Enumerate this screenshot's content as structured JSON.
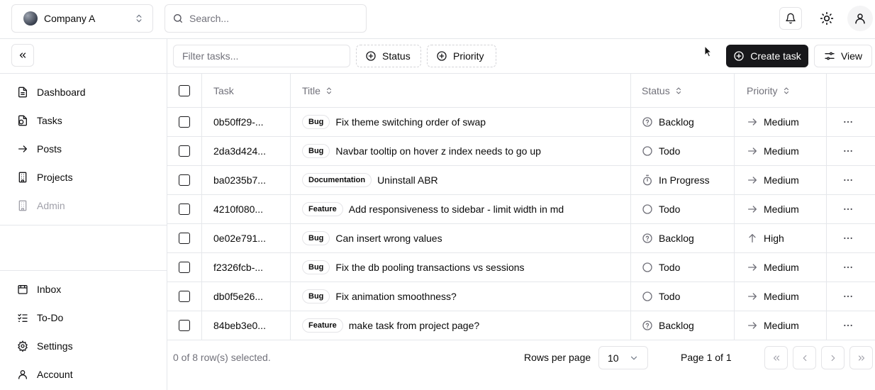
{
  "header": {
    "company": "Company A",
    "search_placeholder": "Search..."
  },
  "sidebar": {
    "main": [
      {
        "label": "Dashboard",
        "icon": "file-text-icon"
      },
      {
        "label": "Tasks",
        "icon": "file-tasks-icon"
      },
      {
        "label": "Posts",
        "icon": "arrow-right-icon"
      },
      {
        "label": "Projects",
        "icon": "building-icon"
      },
      {
        "label": "Admin",
        "icon": "building-icon",
        "disabled": true
      }
    ],
    "bottom": [
      {
        "label": "Inbox",
        "icon": "inbox-icon"
      },
      {
        "label": "To-Do",
        "icon": "list-check-icon"
      },
      {
        "label": "Settings",
        "icon": "gear-icon"
      },
      {
        "label": "Account",
        "icon": "user-icon"
      }
    ]
  },
  "toolbar": {
    "filter_placeholder": "Filter tasks...",
    "status_label": "Status",
    "priority_label": "Priority",
    "create_label": "Create task",
    "view_label": "View"
  },
  "table": {
    "headers": {
      "task": "Task",
      "title": "Title",
      "status": "Status",
      "priority": "Priority"
    },
    "rows": [
      {
        "id": "0b50ff29-...",
        "label": "Bug",
        "title": "Fix theme switching order of swap",
        "status": "Backlog",
        "status_icon": "help-circle-icon",
        "priority": "Medium",
        "priority_icon": "arrow-right-icon"
      },
      {
        "id": "2da3d424...",
        "label": "Bug",
        "title": "Navbar tooltip on hover z index needs to go up",
        "status": "Todo",
        "status_icon": "circle-icon",
        "priority": "Medium",
        "priority_icon": "arrow-right-icon"
      },
      {
        "id": "ba0235b7...",
        "label": "Documentation",
        "title": "Uninstall ABR",
        "status": "In Progress",
        "status_icon": "timer-icon",
        "priority": "Medium",
        "priority_icon": "arrow-right-icon"
      },
      {
        "id": "4210f080...",
        "label": "Feature",
        "title": "Add responsiveness to sidebar - limit width in md",
        "status": "Todo",
        "status_icon": "circle-icon",
        "priority": "Medium",
        "priority_icon": "arrow-right-icon"
      },
      {
        "id": "0e02e791...",
        "label": "Bug",
        "title": "Can insert wrong values",
        "status": "Backlog",
        "status_icon": "help-circle-icon",
        "priority": "High",
        "priority_icon": "arrow-up-icon"
      },
      {
        "id": "f2326fcb-...",
        "label": "Bug",
        "title": "Fix the db pooling transactions vs sessions",
        "status": "Todo",
        "status_icon": "circle-icon",
        "priority": "Medium",
        "priority_icon": "arrow-right-icon"
      },
      {
        "id": "db0f5e26...",
        "label": "Bug",
        "title": "Fix animation smoothness?",
        "status": "Todo",
        "status_icon": "circle-icon",
        "priority": "Medium",
        "priority_icon": "arrow-right-icon"
      },
      {
        "id": "84beb3e0...",
        "label": "Feature",
        "title": "make task from project page?",
        "status": "Backlog",
        "status_icon": "help-circle-icon",
        "priority": "Medium",
        "priority_icon": "arrow-right-icon"
      }
    ]
  },
  "footer": {
    "selected": "0 of 8 row(s) selected.",
    "rows_per_page_label": "Rows per page",
    "rows_per_page_value": "10",
    "page_label": "Page 1 of 1"
  }
}
